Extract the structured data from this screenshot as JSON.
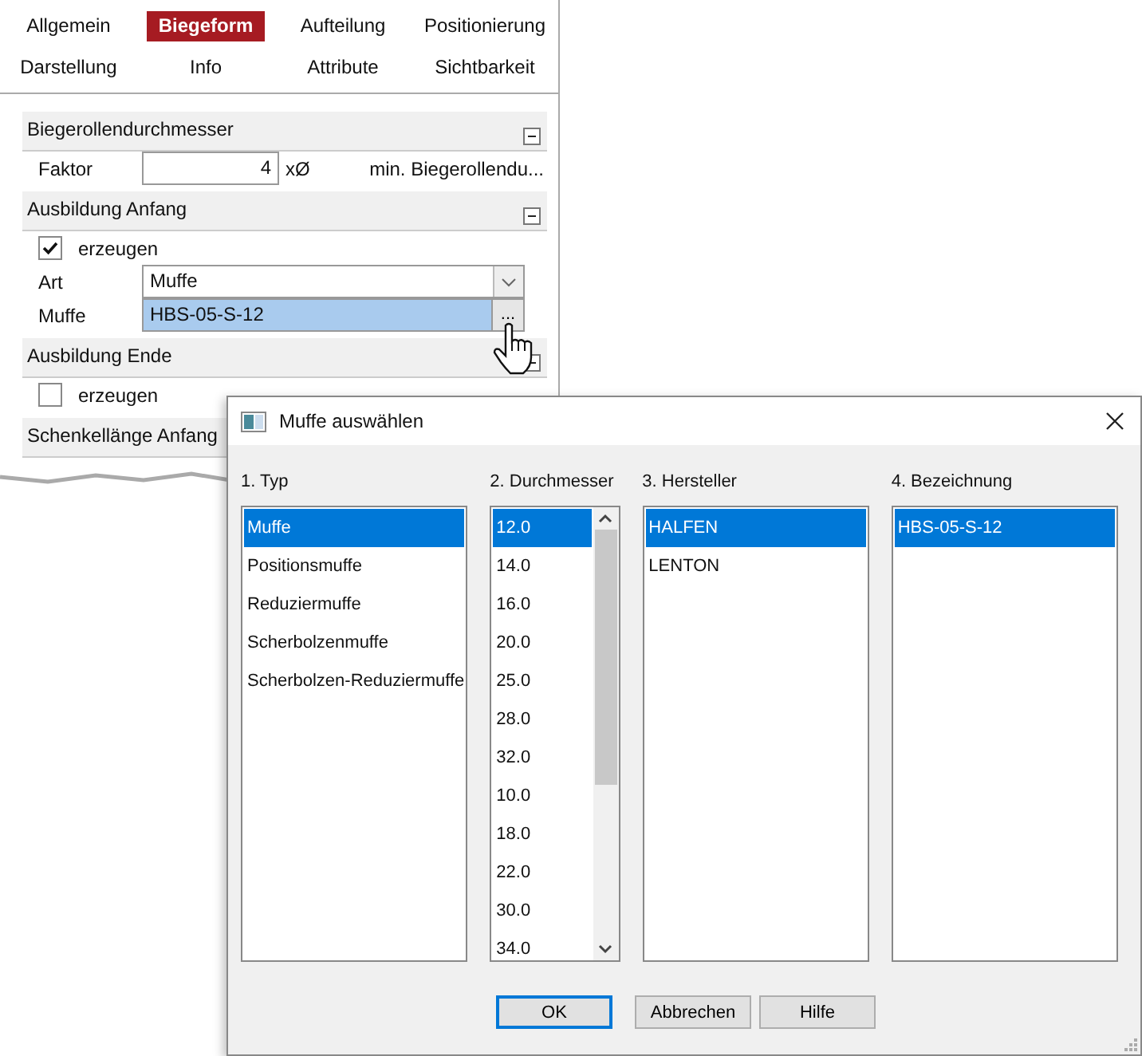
{
  "panel": {
    "tabs": [
      {
        "label": "Allgemein",
        "selected": false
      },
      {
        "label": "Biegeform",
        "selected": true
      },
      {
        "label": "Aufteilung",
        "selected": false
      },
      {
        "label": "Positionierung",
        "selected": false
      },
      {
        "label": "Darstellung",
        "selected": false
      },
      {
        "label": "Info",
        "selected": false
      },
      {
        "label": "Attribute",
        "selected": false
      },
      {
        "label": "Sichtbarkeit",
        "selected": false
      }
    ],
    "sections": [
      {
        "title": "Biegerollendurchmesser",
        "collapse_button": true,
        "rows": [
          {
            "kind": "number",
            "label": "Faktor",
            "value": "4",
            "unit": "xØ",
            "note": "min. Biegerollendu..."
          }
        ]
      },
      {
        "title": "Ausbildung Anfang",
        "collapse_button": true,
        "rows": [
          {
            "kind": "checkbox",
            "label": "erzeugen",
            "checked": true
          },
          {
            "kind": "select",
            "label": "Art",
            "value": "Muffe"
          },
          {
            "kind": "picker",
            "label": "Muffe",
            "value": "HBS-05-S-12",
            "button": "..."
          }
        ]
      },
      {
        "title": "Ausbildung Ende",
        "collapse_button": true,
        "rows": [
          {
            "kind": "checkbox",
            "label": "erzeugen",
            "checked": false
          }
        ]
      },
      {
        "title": "Schenkellänge Anfang"
      }
    ]
  },
  "dialog": {
    "title": "Muffe auswählen",
    "columns": [
      {
        "heading": "1. Typ",
        "scrollbar": false,
        "items": [
          {
            "label": "Muffe",
            "selected": true
          },
          {
            "label": "Positionsmuffe",
            "selected": false
          },
          {
            "label": "Reduziermuffe",
            "selected": false
          },
          {
            "label": "Scherbolzenmuffe",
            "selected": false
          },
          {
            "label": "Scherbolzen-Reduziermuffe",
            "selected": false
          }
        ]
      },
      {
        "heading": "2. Durchmesser",
        "scrollbar": true,
        "items": [
          {
            "label": "12.0",
            "selected": true
          },
          {
            "label": "14.0",
            "selected": false
          },
          {
            "label": "16.0",
            "selected": false
          },
          {
            "label": "20.0",
            "selected": false
          },
          {
            "label": "25.0",
            "selected": false
          },
          {
            "label": "28.0",
            "selected": false
          },
          {
            "label": "32.0",
            "selected": false
          },
          {
            "label": "10.0",
            "selected": false
          },
          {
            "label": "18.0",
            "selected": false
          },
          {
            "label": "22.0",
            "selected": false
          },
          {
            "label": "30.0",
            "selected": false
          },
          {
            "label": "34.0",
            "selected": false
          }
        ]
      },
      {
        "heading": "3. Hersteller",
        "scrollbar": false,
        "items": [
          {
            "label": "HALFEN",
            "selected": true
          },
          {
            "label": "LENTON",
            "selected": false
          }
        ]
      },
      {
        "heading": "4. Bezeichnung",
        "scrollbar": false,
        "items": [
          {
            "label": "HBS-05-S-12",
            "selected": true
          }
        ]
      }
    ],
    "buttons": [
      {
        "label": "OK",
        "default": true
      },
      {
        "label": "Abbrechen",
        "default": false
      },
      {
        "label": "Hilfe",
        "default": false
      }
    ]
  }
}
